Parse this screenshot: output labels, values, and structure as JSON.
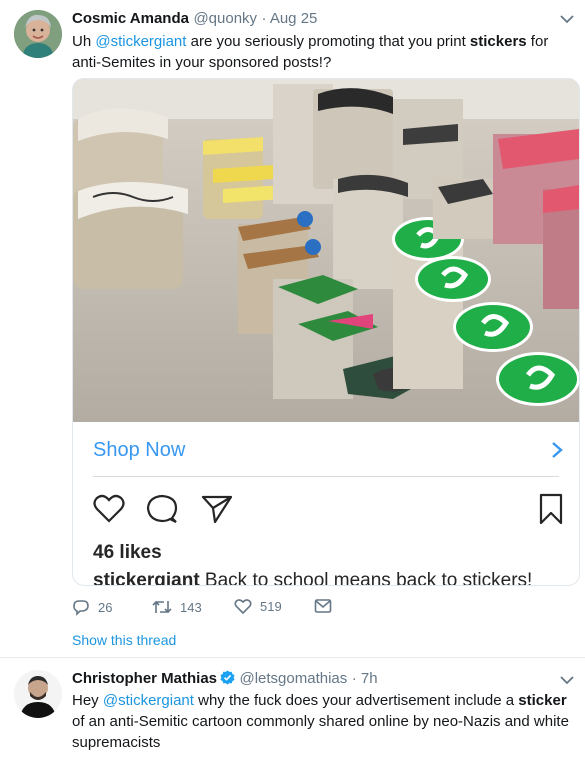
{
  "tweet1": {
    "name": "Cosmic Amanda",
    "handle": "@quonky",
    "time": "· Aug 25",
    "text": {
      "p1": "Uh ",
      "mention": "@stickergiant",
      "p2": " are you seriously promoting that you print ",
      "bold": "stickers",
      "p3": " for anti-Semites in your sponsored posts!?"
    },
    "card": {
      "shop_label": "Shop Now",
      "likes": "46 likes",
      "caption_user": "stickergiant",
      "caption_text": " Back to school means back to stickers!"
    },
    "actions": {
      "replies": "26",
      "retweets": "143",
      "likes": "519"
    },
    "show_thread": "Show this thread"
  },
  "tweet2": {
    "name": "Christopher Mathias",
    "handle": "@letsgomathias",
    "time": "· 7h",
    "text": {
      "p1": "Hey ",
      "mention": "@stickergiant",
      "p2": " why the fuck does your advertisement include a ",
      "bold": "sticker",
      "p3": " of an anti-Semitic cartoon commonly shared online by neo-Nazis and white supremacists"
    }
  },
  "icons": {
    "verified": "verified-badge-icon",
    "reply": "reply-icon",
    "retweet": "retweet-icon",
    "like": "heart-icon",
    "dm": "mail-icon",
    "caret": "chevron-down-icon"
  },
  "colors": {
    "link": "#1b95e0",
    "shop": "#3897f0",
    "muted": "#657786"
  }
}
